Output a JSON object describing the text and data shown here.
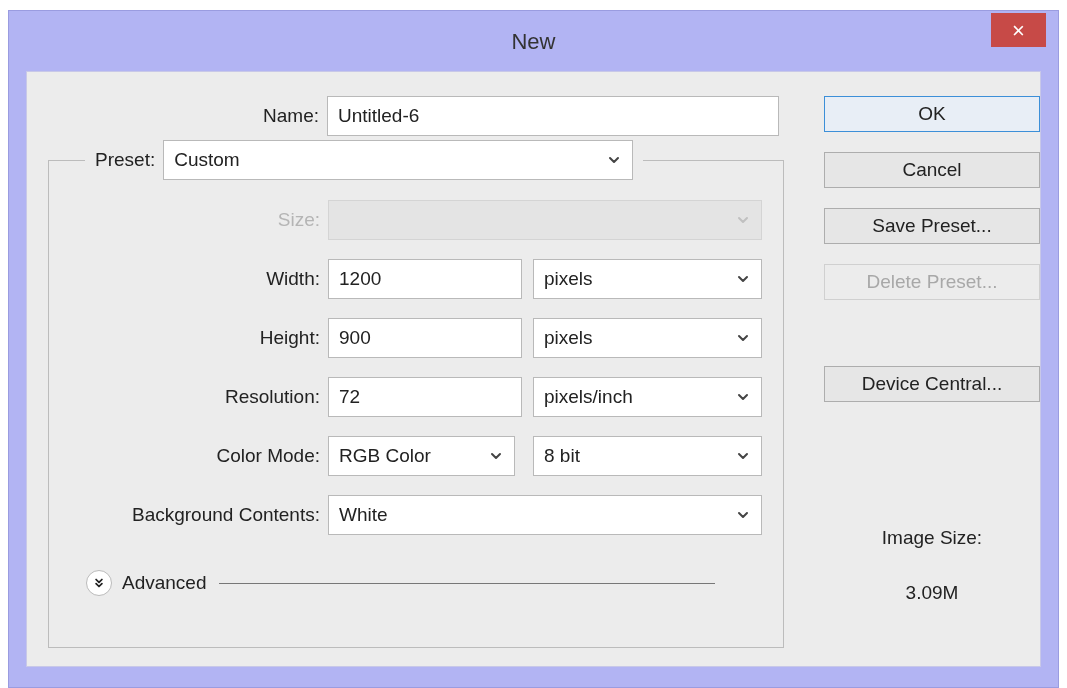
{
  "window": {
    "title": "New",
    "close": "×"
  },
  "name": {
    "label": "Name:",
    "value": "Untitled-6"
  },
  "preset": {
    "label": "Preset:",
    "value": "Custom"
  },
  "size": {
    "label": "Size:",
    "disabled": true
  },
  "fields": [
    {
      "kind": "measure",
      "label": "Width:",
      "value": "1200",
      "unit": "pixels"
    },
    {
      "kind": "measure",
      "label": "Height:",
      "value": "900",
      "unit": "pixels"
    },
    {
      "kind": "measure",
      "label": "Resolution:",
      "value": "72",
      "unit": "pixels/inch"
    },
    {
      "kind": "pair",
      "label": "Color Mode:",
      "value": "RGB Color",
      "unit": "8 bit"
    },
    {
      "kind": "select",
      "label": "Background Contents:",
      "value": "White"
    }
  ],
  "advanced": {
    "label": "Advanced",
    "expanded": false
  },
  "buttons": [
    {
      "label": "OK",
      "focused": true,
      "disabled": false
    },
    {
      "label": "Cancel",
      "focused": false,
      "disabled": false
    },
    {
      "label": "Save Preset...",
      "focused": false,
      "disabled": false
    },
    {
      "label": "Delete Preset...",
      "focused": false,
      "disabled": true
    },
    {
      "label": "Device Central...",
      "focused": false,
      "disabled": false
    }
  ],
  "image_size": {
    "label": "Image Size:",
    "value": "3.09M"
  }
}
